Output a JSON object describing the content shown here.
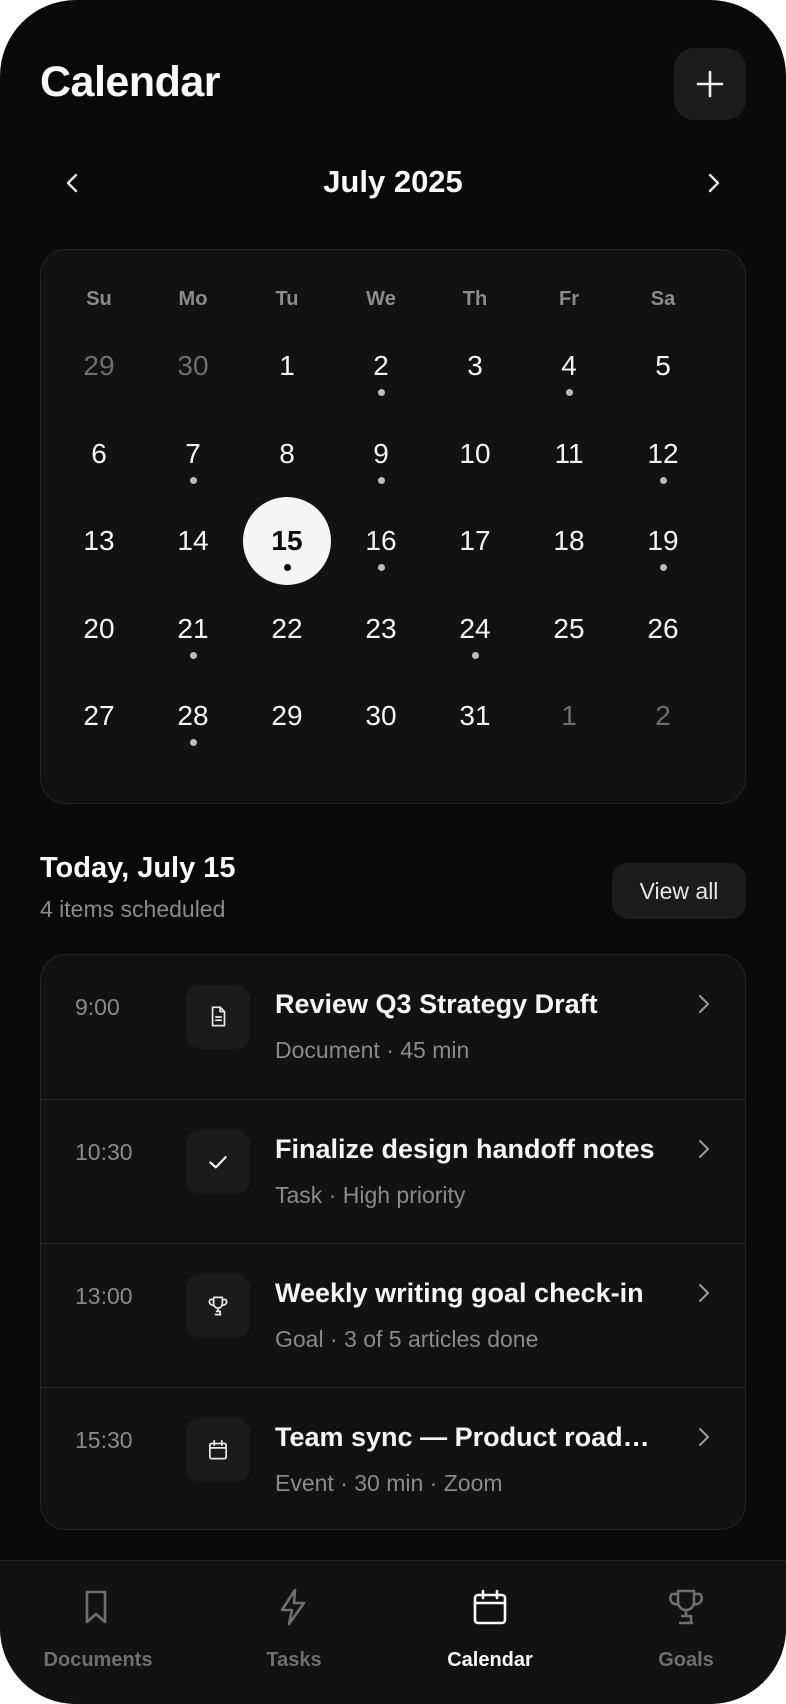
{
  "header": {
    "title": "Calendar",
    "add_icon": "plus-icon"
  },
  "month_nav": {
    "label": "July 2025",
    "prev_icon": "chevron-left-icon",
    "next_icon": "chevron-right-icon"
  },
  "calendar": {
    "weekdays": [
      "Su",
      "Mo",
      "Tu",
      "We",
      "Th",
      "Fr",
      "Sa"
    ],
    "selected_day": "15",
    "weeks": [
      [
        {
          "d": "29",
          "muted": true,
          "dot": false
        },
        {
          "d": "30",
          "muted": true,
          "dot": false
        },
        {
          "d": "1",
          "muted": false,
          "dot": false
        },
        {
          "d": "2",
          "muted": false,
          "dot": true
        },
        {
          "d": "3",
          "muted": false,
          "dot": false
        },
        {
          "d": "4",
          "muted": false,
          "dot": true
        },
        {
          "d": "5",
          "muted": false,
          "dot": false
        }
      ],
      [
        {
          "d": "6",
          "muted": false,
          "dot": false
        },
        {
          "d": "7",
          "muted": false,
          "dot": true
        },
        {
          "d": "8",
          "muted": false,
          "dot": false
        },
        {
          "d": "9",
          "muted": false,
          "dot": true
        },
        {
          "d": "10",
          "muted": false,
          "dot": false
        },
        {
          "d": "11",
          "muted": false,
          "dot": false
        },
        {
          "d": "12",
          "muted": false,
          "dot": true
        }
      ],
      [
        {
          "d": "13",
          "muted": false,
          "dot": false
        },
        {
          "d": "14",
          "muted": false,
          "dot": false
        },
        {
          "d": "15",
          "muted": false,
          "dot": true,
          "selected": true
        },
        {
          "d": "16",
          "muted": false,
          "dot": true
        },
        {
          "d": "17",
          "muted": false,
          "dot": false
        },
        {
          "d": "18",
          "muted": false,
          "dot": false
        },
        {
          "d": "19",
          "muted": false,
          "dot": true
        }
      ],
      [
        {
          "d": "20",
          "muted": false,
          "dot": false
        },
        {
          "d": "21",
          "muted": false,
          "dot": true
        },
        {
          "d": "22",
          "muted": false,
          "dot": false
        },
        {
          "d": "23",
          "muted": false,
          "dot": false
        },
        {
          "d": "24",
          "muted": false,
          "dot": true
        },
        {
          "d": "25",
          "muted": false,
          "dot": false
        },
        {
          "d": "26",
          "muted": false,
          "dot": false
        }
      ],
      [
        {
          "d": "27",
          "muted": false,
          "dot": false
        },
        {
          "d": "28",
          "muted": false,
          "dot": true
        },
        {
          "d": "29",
          "muted": false,
          "dot": false
        },
        {
          "d": "30",
          "muted": false,
          "dot": false
        },
        {
          "d": "31",
          "muted": false,
          "dot": false
        },
        {
          "d": "1",
          "muted": true,
          "dot": false
        },
        {
          "d": "2",
          "muted": true,
          "dot": false
        }
      ]
    ]
  },
  "schedule": {
    "title": "Today, July 15",
    "subtitle": "4 items scheduled",
    "view_all": "View all",
    "events": [
      {
        "time": "9:00",
        "title": "Review Q3 Strategy Draft",
        "meta": "Document · 45 min",
        "icon": "document-icon"
      },
      {
        "time": "10:30",
        "title": "Finalize design handoff notes",
        "meta": "Task · High priority",
        "icon": "check-icon"
      },
      {
        "time": "13:00",
        "title": "Weekly writing goal check-in",
        "meta": "Goal · 3 of 5 articles done",
        "icon": "trophy-icon"
      },
      {
        "time": "15:30",
        "title": "Team sync — Product road…",
        "meta": "Event · 30 min · Zoom",
        "icon": "calendar-icon"
      }
    ]
  },
  "tab_bar": {
    "active": "Calendar",
    "tabs": [
      {
        "label": "Documents",
        "icon": "bookmark-icon"
      },
      {
        "label": "Tasks",
        "icon": "lightning-icon"
      },
      {
        "label": "Calendar",
        "icon": "calendar-icon"
      },
      {
        "label": "Goals",
        "icon": "trophy-icon"
      }
    ]
  },
  "colors": {
    "background": "#0a0a0a",
    "card": "#121212",
    "accent": "#f5f5f5",
    "muted_text": "#8a8a8a"
  }
}
